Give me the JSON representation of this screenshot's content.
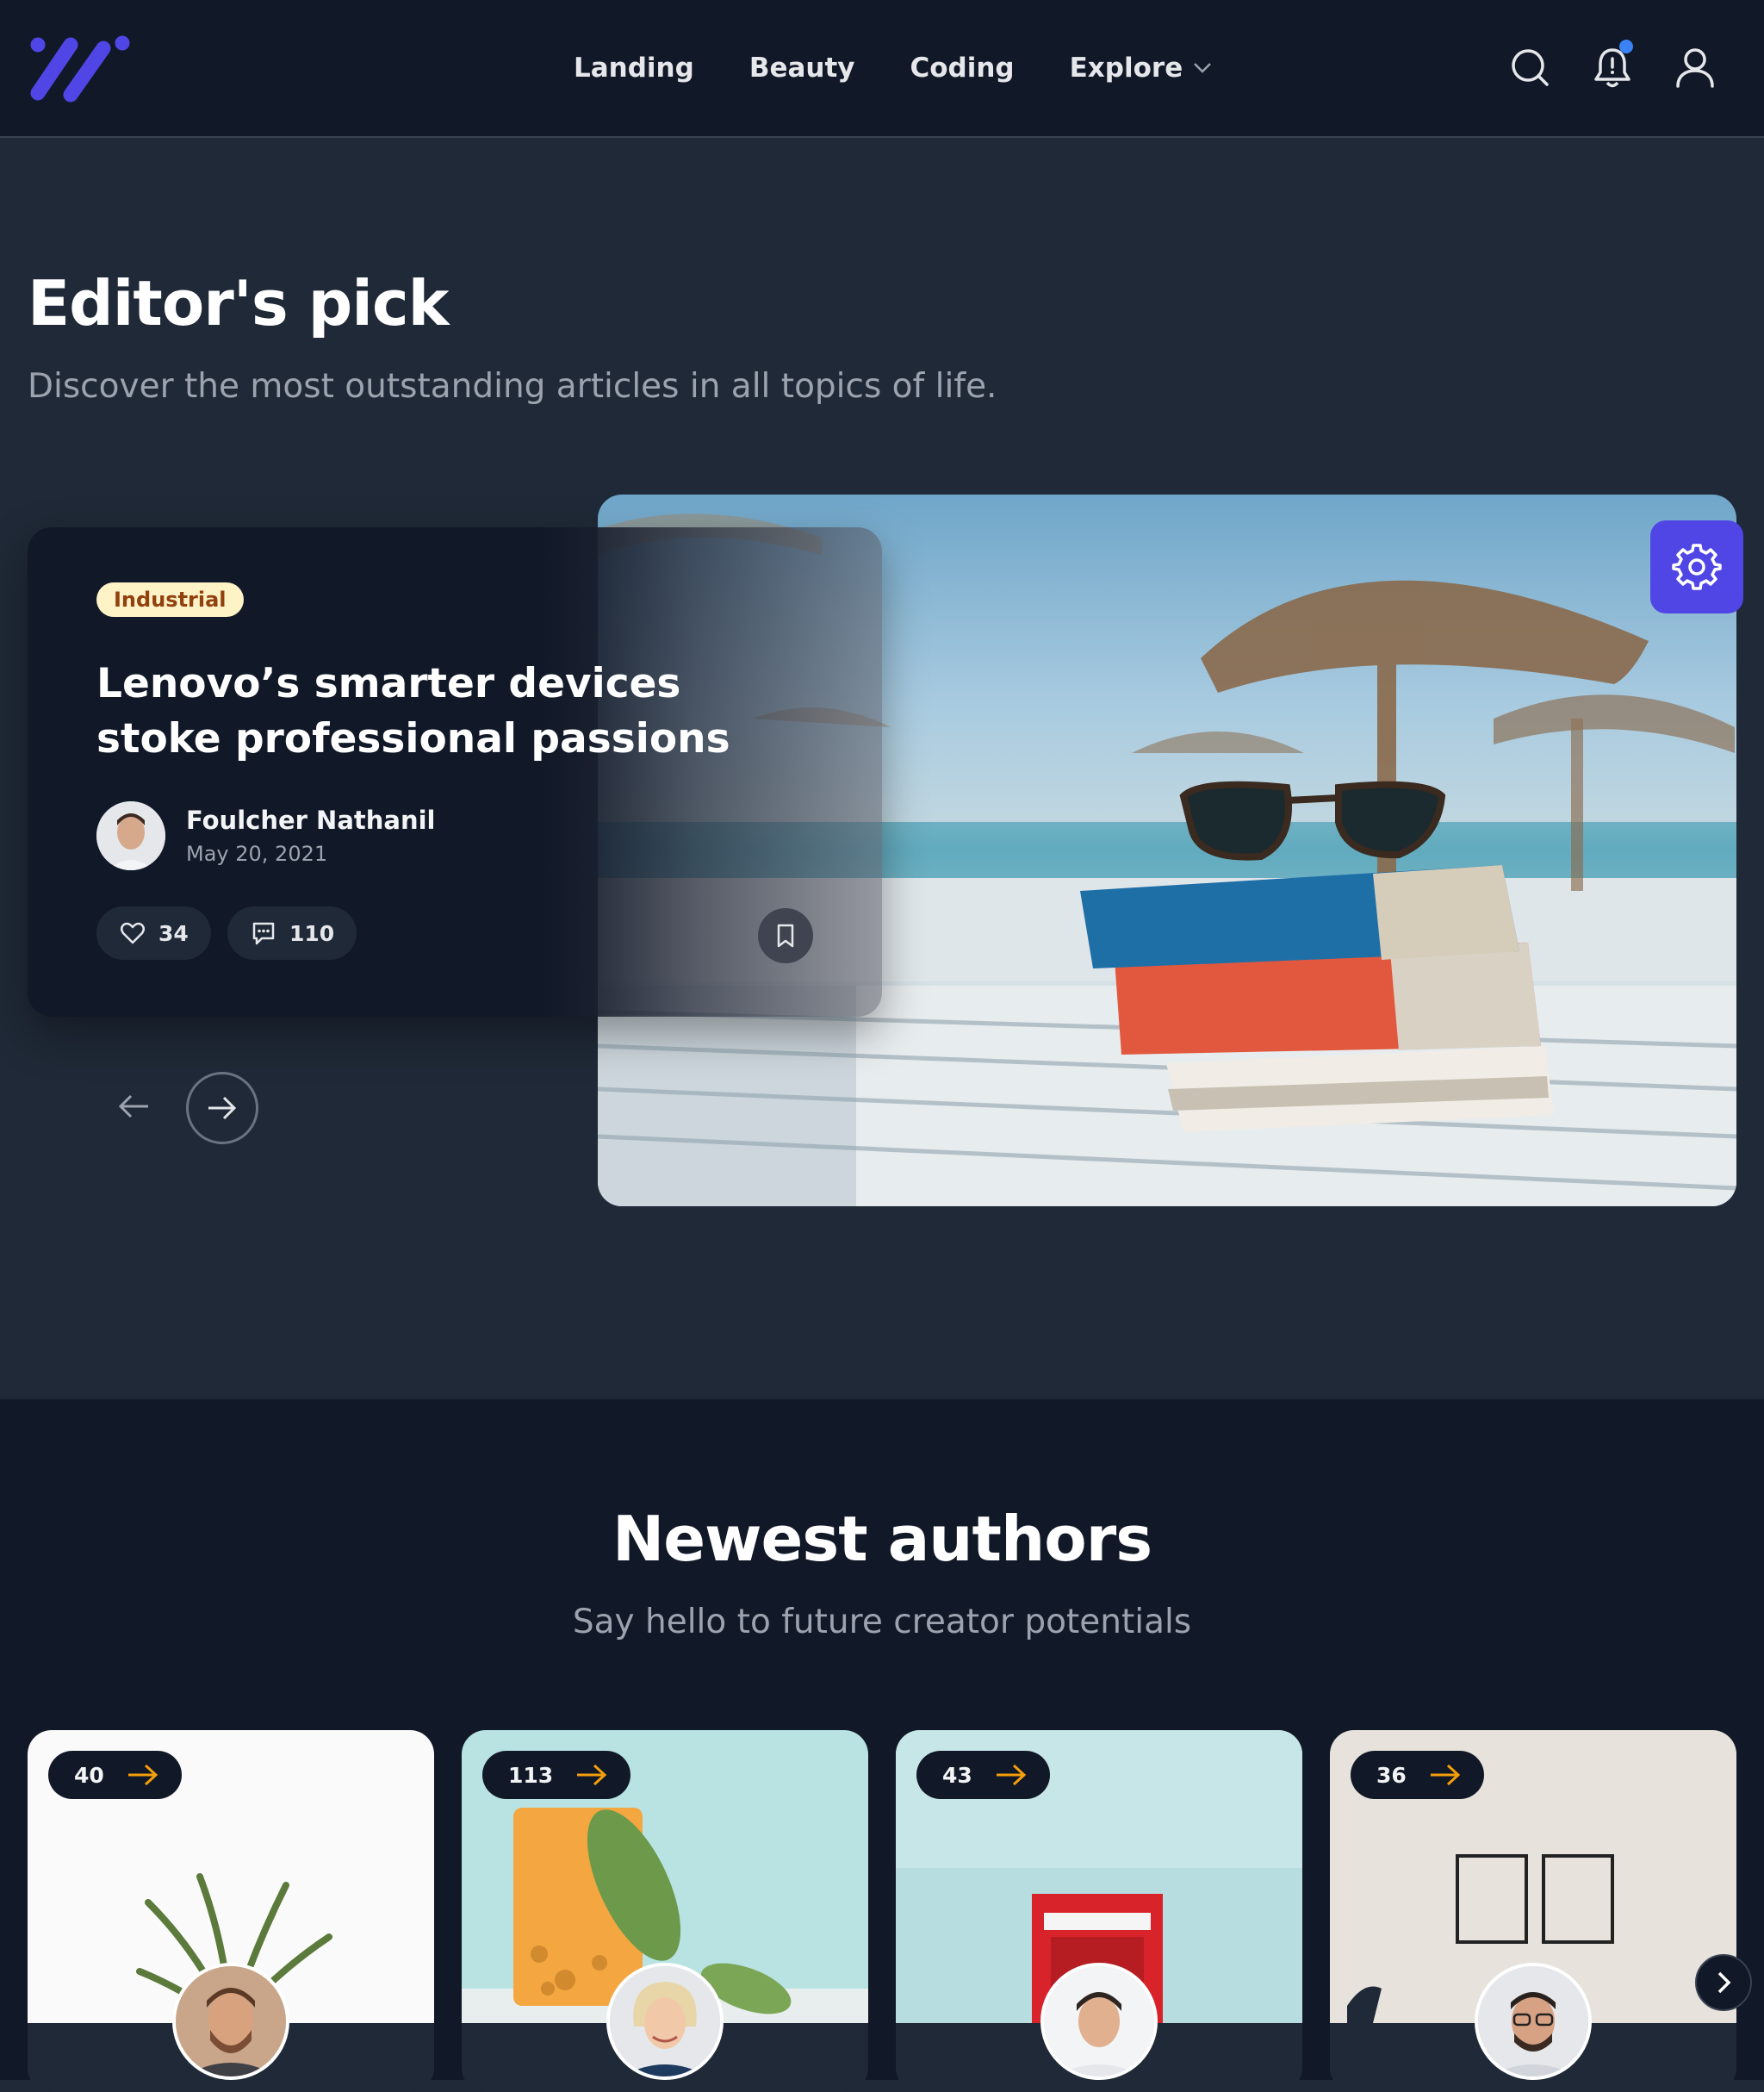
{
  "header": {
    "nav": [
      {
        "label": "Landing"
      },
      {
        "label": "Beauty"
      },
      {
        "label": "Coding"
      },
      {
        "label": "Explore"
      }
    ],
    "icons": [
      "logo-icon",
      "search-icon",
      "bell-icon",
      "user-icon"
    ],
    "accent": "#4f46e5"
  },
  "editors_pick": {
    "title": "Editor's pick",
    "subtitle": "Discover the most outstanding articles in all topics of life.",
    "article": {
      "category": "Industrial",
      "title": "Lenovo’s smarter devices stoke professional passions",
      "author": "Foulcher Nathanil",
      "date": "May 20, 2021",
      "likes": "34",
      "comments": "110"
    }
  },
  "newest_authors": {
    "title": "Newest authors",
    "subtitle": "Say hello to future creator potentials",
    "authors": [
      {
        "count": "40"
      },
      {
        "count": "113"
      },
      {
        "count": "43"
      },
      {
        "count": "36"
      }
    ]
  }
}
